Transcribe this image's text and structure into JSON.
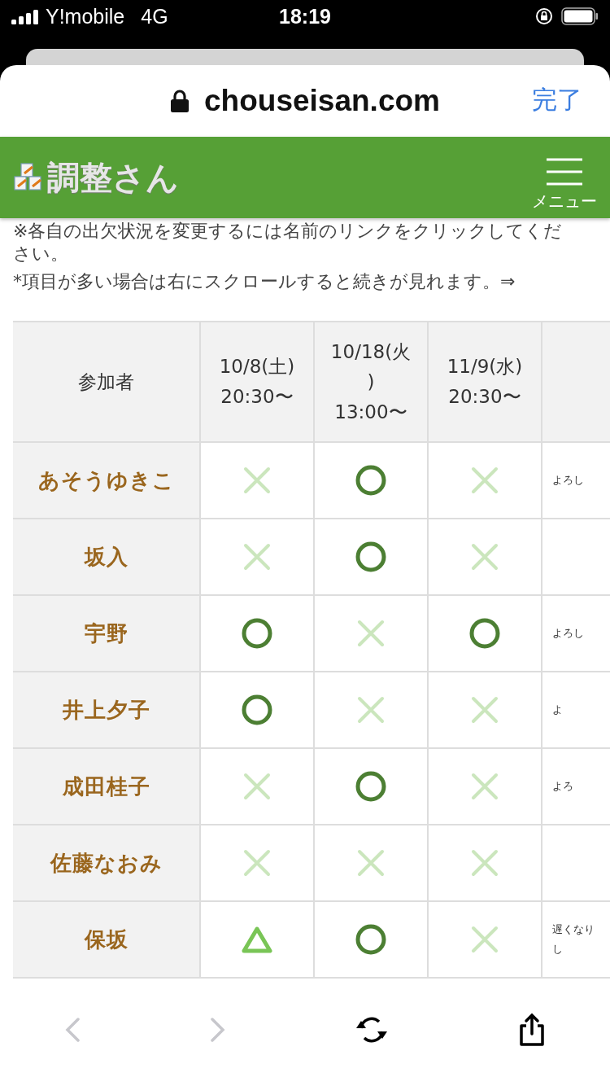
{
  "status_bar": {
    "carrier": "Y!mobile",
    "network": "4G",
    "time": "18:19"
  },
  "browser": {
    "url": "chouseisan.com",
    "done_button": "完了"
  },
  "header": {
    "logo": "調整さん",
    "menu_label": "メニュー"
  },
  "notes": [
    "※各自の出欠状況を変更するには名前のリンクをクリックしてください。",
    "*項目が多い場合は右にスクロールすると続きが見れます。⇒"
  ],
  "table": {
    "columns": [
      "参加者",
      "10/8(土) 20:30〜",
      "10/18(火) 13:00〜",
      "11/9(水) 20:30〜"
    ],
    "rows": [
      {
        "name": "あそうゆきこ",
        "answers": [
          {
            "kind": "no"
          },
          {
            "kind": "yes"
          },
          {
            "kind": "no"
          }
        ],
        "comment": "よろし"
      },
      {
        "name": "坂入",
        "answers": [
          {
            "kind": "no"
          },
          {
            "kind": "yes"
          },
          {
            "kind": "no"
          }
        ]
      },
      {
        "name": "宇野",
        "answers": [
          {
            "kind": "yes"
          },
          {
            "kind": "no"
          },
          {
            "kind": "yes"
          }
        ],
        "comment": "よろし"
      },
      {
        "name": "井上夕子",
        "answers": [
          {
            "kind": "yes"
          },
          {
            "kind": "no"
          },
          {
            "kind": "no"
          }
        ],
        "comment": "よ"
      },
      {
        "name": "成田桂子",
        "answers": [
          {
            "kind": "no"
          },
          {
            "kind": "yes"
          },
          {
            "kind": "no"
          }
        ],
        "comment": "よろ"
      },
      {
        "name": "佐藤なおみ",
        "answers": [
          {
            "kind": "no"
          },
          {
            "kind": "no"
          },
          {
            "kind": "no"
          }
        ]
      },
      {
        "name": "保坂",
        "answers": [
          {
            "kind": "maybe"
          },
          {
            "kind": "yes"
          },
          {
            "kind": "no"
          }
        ],
        "comment": "遅くなりし"
      }
    ]
  }
}
